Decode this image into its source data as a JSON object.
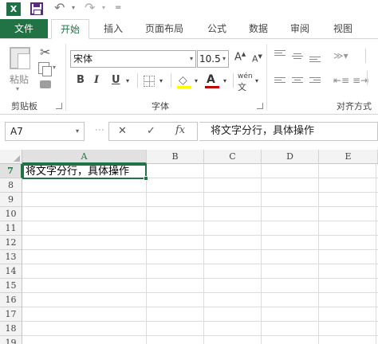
{
  "app": {
    "logo_text": "X",
    "accent_color": "#217346"
  },
  "quick_access": {
    "undo_symbol": "↶",
    "redo_symbol": "↷",
    "dropdown_symbol": "▾",
    "customize_symbol": "="
  },
  "tabs": [
    {
      "label": "文件"
    },
    {
      "label": "开始"
    },
    {
      "label": "插入"
    },
    {
      "label": "页面布局"
    },
    {
      "label": "公式"
    },
    {
      "label": "数据"
    },
    {
      "label": "审阅"
    },
    {
      "label": "视图"
    }
  ],
  "ribbon": {
    "clipboard": {
      "paste_label": "粘贴",
      "group_label": "剪贴板"
    },
    "font": {
      "font_name": "宋体",
      "font_size": "10.5",
      "grow_label": "A",
      "shrink_label": "A",
      "bold_label": "B",
      "italic_label": "I",
      "underline_label": "U",
      "font_color_label": "A",
      "phonetic_label": "wén",
      "group_label": "字体"
    },
    "alignment": {
      "group_label": "对齐方式"
    }
  },
  "formula_bar": {
    "name_box": "A7",
    "cancel_symbol": "✕",
    "enter_symbol": "✓",
    "fx_label": "fx",
    "formula": "将文字分行，具体操作"
  },
  "grid": {
    "columns": [
      "A",
      "B",
      "C",
      "D",
      "E"
    ],
    "selected_column": "A",
    "rows": [
      "7",
      "8",
      "9",
      "10",
      "11",
      "12",
      "13",
      "14",
      "15",
      "16",
      "17",
      "18",
      "19"
    ],
    "selected_row": "7",
    "active_cell_value": "将文字分行，具体操作"
  }
}
